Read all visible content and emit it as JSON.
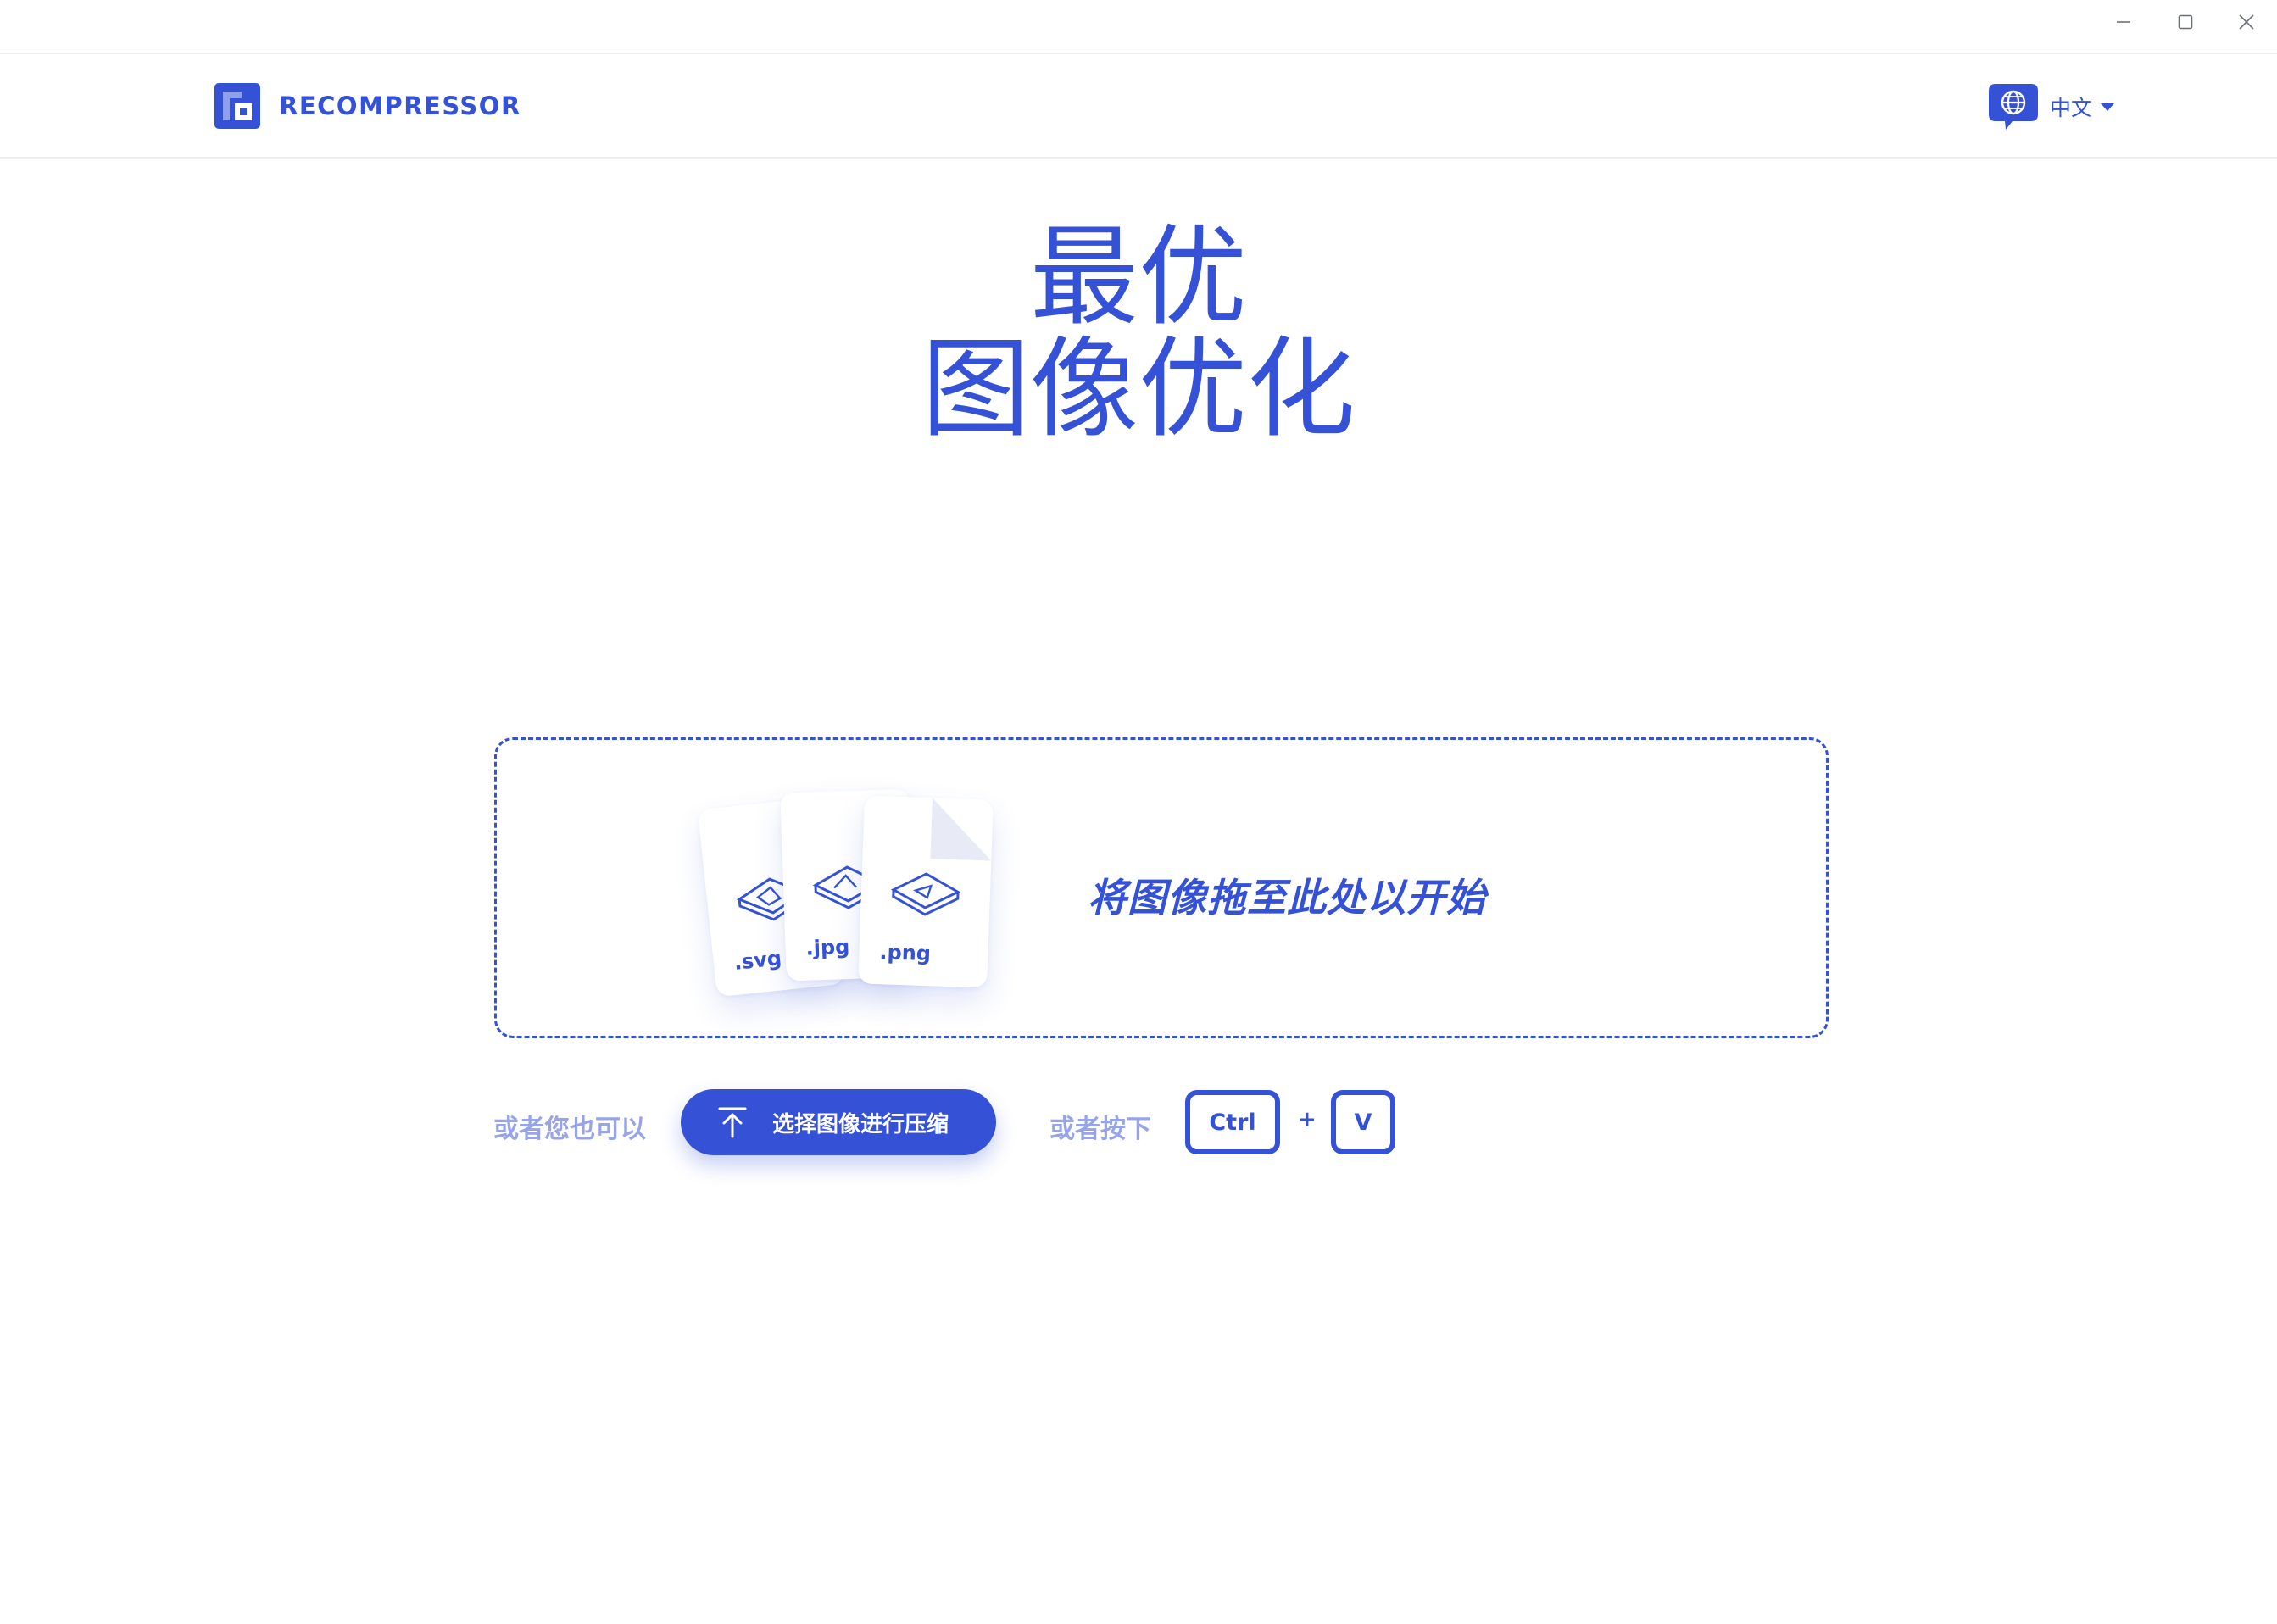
{
  "window": {
    "controls": {
      "minimize": "minimize-icon",
      "maximize": "maximize-icon",
      "close": "close-icon"
    }
  },
  "header": {
    "brand_name": "RECOMPRESSOR",
    "logo_icon": "recompressor-logo",
    "language": {
      "icon": "globe-chat-icon",
      "label": "中文"
    }
  },
  "hero": {
    "line1": "最优",
    "line2": "图像优化"
  },
  "dropzone": {
    "prompt": "将图像拖至此处以开始",
    "file_types": [
      ".svg",
      ".jpg",
      ".png"
    ]
  },
  "actions": {
    "or_you_can": "或者您也可以",
    "upload_button_label": "选择图像进行压缩",
    "upload_icon": "upload-arrow-icon",
    "or_press": "或者按下",
    "shortcut_keys": [
      "Ctrl",
      "V"
    ],
    "shortcut_joiner": "+"
  },
  "colors": {
    "accent": "#3552d6",
    "muted_accent": "#97a4e6",
    "background": "#ffffff",
    "divider": "#eceef2"
  }
}
